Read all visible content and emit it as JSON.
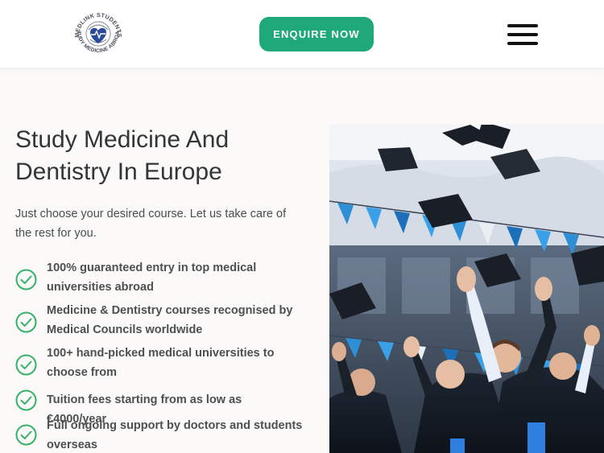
{
  "header": {
    "logo_alt": "Medlink Students - Study Medicine Abroad",
    "logo_text_top": "MEDLINK STUDENTS",
    "logo_text_bottom": "STUDY MEDICINE ABROAD",
    "enquire_label": "ENQUIRE NOW",
    "menu_icon": "hamburger-menu-icon",
    "accent_color": "#1fa97a"
  },
  "hero": {
    "title": "Study Medicine And Dentistry In Europe",
    "subtitle": "Just choose your desired course. Let us take care of the rest for you.",
    "image_alt": "Graduates throwing caps in the air",
    "features": [
      {
        "icon": "check-circle-icon",
        "text": "100% guaranteed entry in top medical universities abroad"
      },
      {
        "icon": "check-circle-icon",
        "text": "Medicine & Dentistry courses recognised by Medical Councils worldwide"
      },
      {
        "icon": "check-circle-icon",
        "text": "100+ hand-picked medical universities to choose from"
      },
      {
        "icon": "check-circle-icon",
        "text": "Tuition fees starting from as low as €4000/year"
      },
      {
        "icon": "check-circle-icon",
        "text": "Full ongoing support by doctors and students overseas"
      }
    ]
  }
}
